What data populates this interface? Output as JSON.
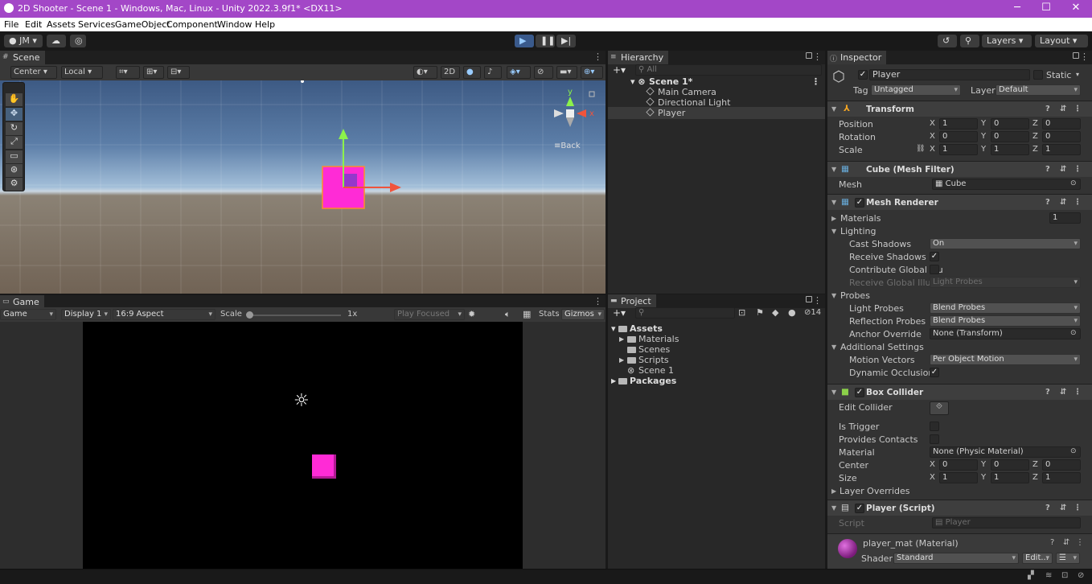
{
  "window": {
    "title": "2D Shooter - Scene 1 - Windows, Mac, Linux - Unity 2022.3.9f1* <DX11>",
    "min": "─",
    "max": "☐",
    "close": "✕"
  },
  "menu": [
    "File",
    "Edit",
    "Assets",
    "Services",
    "GameObject",
    "Component",
    "Window",
    "Help"
  ],
  "toolbar": {
    "account": "JM",
    "layers": "Layers",
    "layout": "Layout"
  },
  "scene": {
    "tab": "Scene",
    "pivot": "Center",
    "space": "Local",
    "mode_2d": "2D",
    "back_label": "Back",
    "gizmo_y": "y",
    "gizmo_x": "x"
  },
  "game": {
    "tab": "Game",
    "view": "Game",
    "display": "Display 1",
    "aspect": "16:9 Aspect",
    "scale_label": "Scale",
    "scale_value": "1x",
    "play_mode": "Play Focused",
    "stats": "Stats",
    "gizmos": "Gizmos"
  },
  "hierarchy": {
    "tab": "Hierarchy",
    "search_placeholder": "All",
    "scene": "Scene 1*",
    "items": [
      "Main Camera",
      "Directional Light",
      "Player"
    ]
  },
  "project": {
    "tab": "Project",
    "badge": "14",
    "root": "Assets",
    "folders": [
      "Materials",
      "Scenes",
      "Scripts"
    ],
    "scene_asset": "Scene 1",
    "packages": "Packages"
  },
  "inspector": {
    "tab": "Inspector",
    "name": "Player",
    "static": "Static",
    "tag_label": "Tag",
    "tag": "Untagged",
    "layer_label": "Layer",
    "layer": "Default",
    "transform": {
      "title": "Transform",
      "position_label": "Position",
      "position": [
        "1",
        "0",
        "0"
      ],
      "rotation_label": "Rotation",
      "rotation": [
        "0",
        "0",
        "0"
      ],
      "scale_label": "Scale",
      "scale": [
        "1",
        "1",
        "1"
      ]
    },
    "axes": [
      "X",
      "Y",
      "Z"
    ],
    "mesh_filter": {
      "title": "Cube (Mesh Filter)",
      "mesh_label": "Mesh",
      "mesh": "Cube"
    },
    "mesh_renderer": {
      "title": "Mesh Renderer",
      "materials_label": "Materials",
      "materials_count": "1",
      "lighting": "Lighting",
      "cast_shadows_label": "Cast Shadows",
      "cast_shadows": "On",
      "receive_shadows_label": "Receive Shadows",
      "contribute_gi_label": "Contribute Global Illu",
      "receive_gi_label": "Receive Global Illumi",
      "receive_gi": "Light Probes",
      "probes": "Probes",
      "light_probes_label": "Light Probes",
      "light_probes": "Blend Probes",
      "reflection_probes_label": "Reflection Probes",
      "reflection_probes": "Blend Probes",
      "anchor_label": "Anchor Override",
      "anchor": "None (Transform)",
      "additional": "Additional Settings",
      "motion_label": "Motion Vectors",
      "motion": "Per Object Motion",
      "occlusion_label": "Dynamic Occlusion"
    },
    "box_collider": {
      "title": "Box Collider",
      "edit_label": "Edit Collider",
      "trigger_label": "Is Trigger",
      "contacts_label": "Provides Contacts",
      "material_label": "Material",
      "material": "None (Physic Material)",
      "center_label": "Center",
      "center": [
        "0",
        "0",
        "0"
      ],
      "size_label": "Size",
      "size": [
        "1",
        "1",
        "1"
      ],
      "overrides_label": "Layer Overrides"
    },
    "script": {
      "title": "Player (Script)",
      "script_label": "Script",
      "script": "Player"
    },
    "material": {
      "name": "player_mat (Material)",
      "shader_label": "Shader",
      "shader": "Standard",
      "edit": "Edit..."
    }
  },
  "colors": {
    "title_bar": "#a347c7",
    "player": "#ff2bd6",
    "sky_top": "#3d5a84",
    "ground": "#716355"
  }
}
